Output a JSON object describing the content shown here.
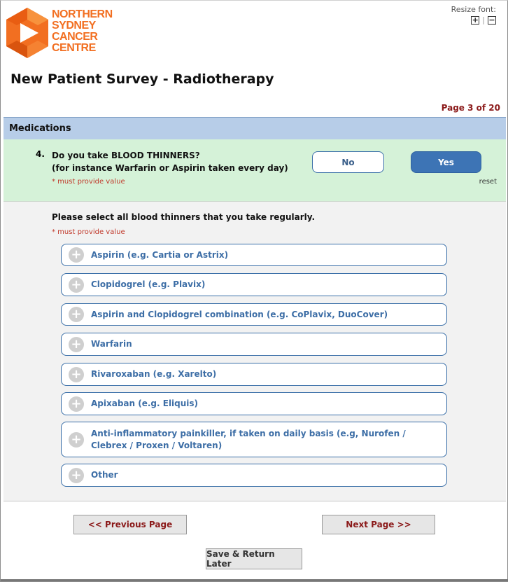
{
  "logo": {
    "lines": [
      "NORTHERN",
      "SYDNEY",
      "CANCER",
      "CENTRE"
    ],
    "color": "#f26f21"
  },
  "resize_font": {
    "label": "Resize font:",
    "increase_icon": "plus-box-icon",
    "decrease_icon": "minus-box-icon",
    "separator": "|"
  },
  "page_title": "New Patient Survey - Radiotherapy",
  "page_indicator": "Page 3 of 20",
  "section": {
    "title": "Medications"
  },
  "question": {
    "number": "4.",
    "line1": "Do you take BLOOD THINNERS?",
    "line2": "(for instance Warfarin or Aspirin taken every day)",
    "required_text": "* must provide value",
    "options": {
      "no": "No",
      "yes": "Yes"
    },
    "selected": "Yes",
    "reset_label": "reset"
  },
  "sub_question": {
    "text": "Please select all blood thinners that you take regularly.",
    "required_text": "* must provide value",
    "items": [
      {
        "label": "Aspirin (e.g. Cartia or Astrix)"
      },
      {
        "label": "Clopidogrel (e.g. Plavix)"
      },
      {
        "label": "Aspirin and Clopidogrel combination (e.g. CoPlavix, DuoCover)"
      },
      {
        "label": "Warfarin"
      },
      {
        "label": "Rivaroxaban (e.g. Xarelto)"
      },
      {
        "label": "Apixaban (e.g. Eliquis)"
      },
      {
        "label": "Anti-inflammatory painkiller, if taken on daily basis (e.g, Nurofen / Clebrex / Proxen / Voltaren)"
      },
      {
        "label": "Other"
      }
    ],
    "icon": "plus-circle-icon"
  },
  "navigation": {
    "previous": "<< Previous Page",
    "next": "Next Page >>",
    "save": "Save & Return Later"
  },
  "colors": {
    "section_header": "#b7cde8",
    "question_bg": "#d5f2d8",
    "selected_button": "#3d74b5",
    "link_text": "#3d6ea6",
    "required": "#c0392b",
    "page_indicator": "#8b1a1a"
  }
}
